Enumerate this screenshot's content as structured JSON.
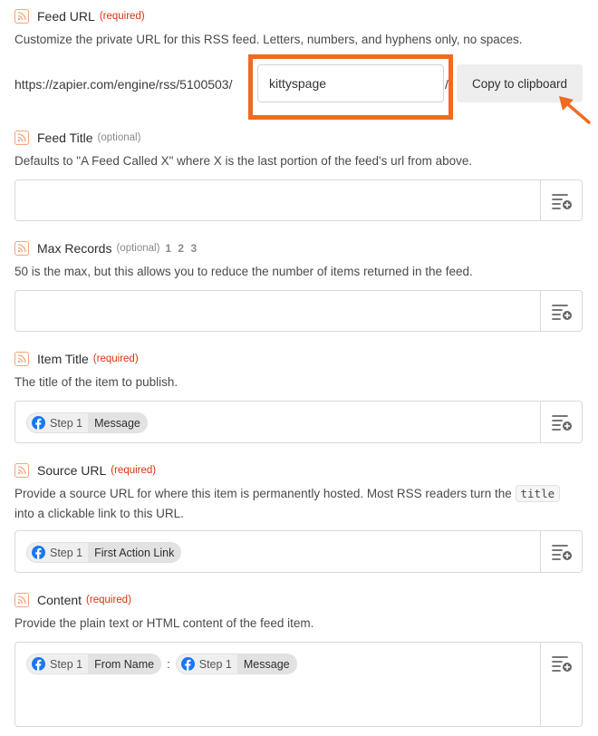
{
  "feed_url": {
    "label": "Feed URL",
    "tag": "(required)",
    "description": "Customize the private URL for this RSS feed. Letters, numbers, and hyphens only, no spaces.",
    "prefix": "https://zapier.com/engine/rss/5100503/",
    "value": "kittyspage",
    "slash": "/",
    "copy_label": "Copy to clipboard"
  },
  "feed_title": {
    "label": "Feed Title",
    "tag": "(optional)",
    "description": "Defaults to \"A Feed Called X\" where X is the last portion of the feed's url from above."
  },
  "max_records": {
    "label": "Max Records",
    "tag": "(optional)",
    "numbers": "1 2 3",
    "description": "50 is the max, but this allows you to reduce the number of items returned in the feed."
  },
  "item_title": {
    "label": "Item Title",
    "tag": "(required)",
    "description": "The title of the item to publish.",
    "pill": {
      "step": "Step 1",
      "value": "Message"
    }
  },
  "source_url": {
    "label": "Source URL",
    "tag": "(required)",
    "description_before": "Provide a source URL for where this item is permanently hosted. Most RSS readers turn the ",
    "code": "title",
    "description_after": " into a clickable link to this URL.",
    "pill": {
      "step": "Step 1",
      "value": "First Action Link"
    }
  },
  "content": {
    "label": "Content",
    "tag": "(required)",
    "description": "Provide the plain text or HTML content of the feed item.",
    "pills": [
      {
        "step": "Step 1",
        "value": "From Name"
      },
      {
        "step": "Step 1",
        "value": "Message"
      }
    ],
    "separator": ":"
  },
  "icons": {
    "field_icon": "rss-icon",
    "insert_icon": "insert-data-icon",
    "app_icon": "facebook-icon"
  },
  "colors": {
    "required": "#d8330a",
    "highlight": "#f26a21",
    "facebook": "#1877f2"
  }
}
